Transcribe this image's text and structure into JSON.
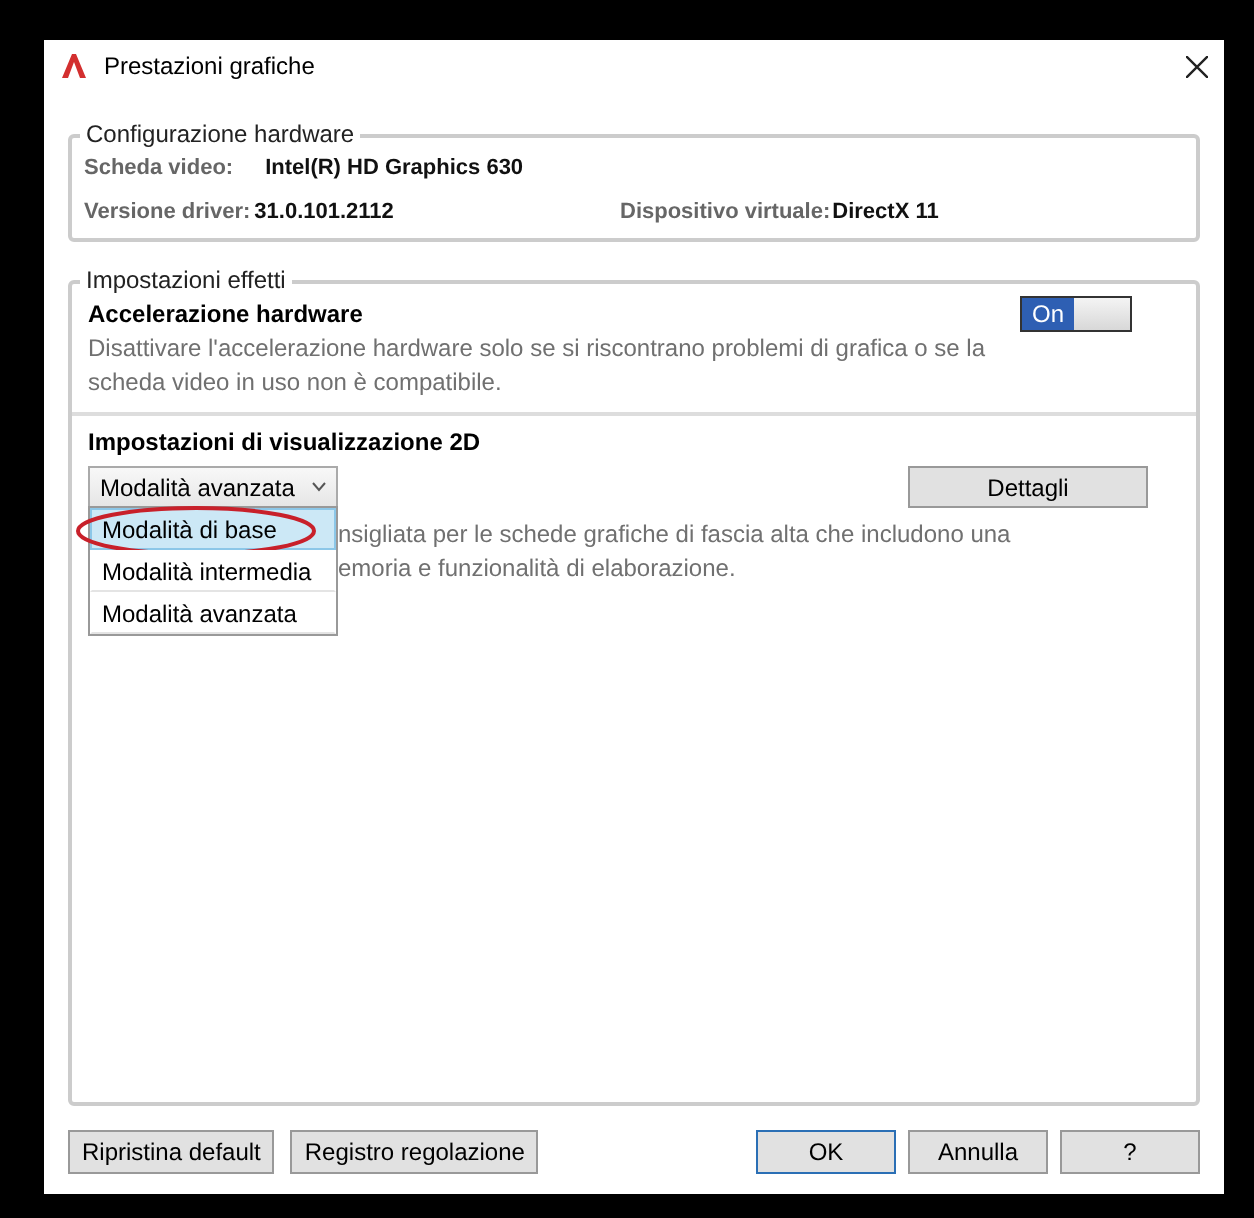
{
  "window": {
    "title": "Prestazioni grafiche"
  },
  "hardware": {
    "title": "Configurazione hardware",
    "rows": [
      {
        "label": "Scheda video:",
        "value": "Intel(R) HD Graphics 630"
      },
      {
        "label": "Versione driver:",
        "value": "31.0.101.2112",
        "label_2": "Dispositivo virtuale:",
        "value_2": "DirectX 11"
      }
    ]
  },
  "effects": {
    "title": "Impostazioni effetti",
    "acceleration": {
      "title": "Accelerazione hardware",
      "description": "Disattivare l'accelerazione hardware solo se si riscontrano problemi di grafica o se la scheda video in uso non è compatibile.",
      "toggle": {
        "label": "On",
        "on": true
      }
    },
    "display_2d": {
      "title": "Impostazioni di visualizzazione 2D",
      "dropdown": {
        "value": "Modalità avanzata",
        "expanded": true,
        "options": [
          {
            "label": "Modalità di base",
            "highlighted": true,
            "circled": true
          },
          {
            "label": "Modalità intermedia",
            "highlighted": false,
            "circled": false
          },
          {
            "label": "Modalità avanzata",
            "highlighted": false,
            "circled": false
          }
        ]
      },
      "details_button": "Dettagli",
      "description_lines": [
        "nsigliata per le schede grafiche di fascia alta che includono una",
        "emoria e funzionalità di elaborazione."
      ]
    }
  },
  "buttons_left": [
    "Ripristina default",
    "Registro regolazione"
  ],
  "buttons_right": [
    {
      "label": "OK",
      "default": true
    },
    {
      "label": "Annulla",
      "default": false
    },
    {
      "label": "?",
      "default": false
    }
  ]
}
